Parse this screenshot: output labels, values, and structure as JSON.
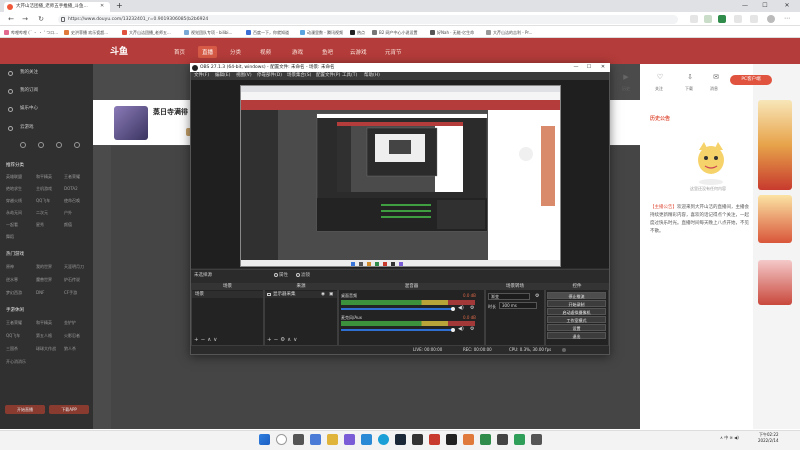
{
  "browser": {
    "tab_title": "大芹山洁团播_老师五手推播_斗鱼...",
    "url": "https://www.douyu.com/13232401_r=0.9019306085(b2b6924",
    "bookmarks": [
      "哔哩哔哩 (´ ・ ・ ‘ つロ...",
      "史洪菲播 欢乐瓷超...",
      "大芹山洁团播_老师五...",
      "视觉团队专项 - bilibi...",
      "百度一下，你就知道",
      "动漫里数 - 腾讯视频",
      "热点",
      "B2 网产中心小说设置",
      "好Nah · 无能·亿生命",
      "大芹山洁的吉利 - Pr..."
    ],
    "controls": {
      "minimize": "—",
      "maximize": "☐",
      "close": "✕",
      "new_tab": "+",
      "tab_close": "✕",
      "back": "←",
      "forward": "→",
      "refresh": "↻"
    }
  },
  "site": {
    "logo": "斗鱼",
    "nav": [
      "首页",
      "直播",
      "分类",
      "视频",
      "游戏",
      "鱼吧",
      "云游戏",
      "元宵节"
    ],
    "header_buttons": [
      "历史",
      "关注",
      "下载",
      "消息",
      "创作"
    ],
    "pc_client": "PC客户端",
    "sidebar": {
      "top_items": [
        "我的关注",
        "我的订阅",
        "娱乐中心",
        "云游戏"
      ],
      "section1_title": "推荐分类",
      "section1_items": [
        "英雄联盟",
        "和平精英",
        "王者荣耀",
        "绝地求生",
        "主机游戏",
        "DOTA2",
        "穿越火线",
        "QQ飞车",
        "使命召唤",
        "永劫无间",
        "二次元",
        "户外",
        "一起看",
        "星秀",
        "颜值",
        "舞蹈"
      ],
      "section2_title": "热门游戏",
      "section2_items": [
        "原神",
        "我的世界",
        "天涯明月刀",
        "逆水寒",
        "魔兽世界",
        "炉石传说",
        "梦幻西游",
        "DNF",
        "CF手游"
      ],
      "section3_title": "手游休闲",
      "section3_items": [
        "王者荣耀",
        "和平精英",
        "金铲铲",
        "QQ飞车",
        "第五人格",
        "火影忍者",
        "三国杀",
        "球球大作战",
        "狼人杀",
        "开心消消乐"
      ],
      "bottom_buttons": [
        "开始直播",
        "下载APP"
      ]
    },
    "streamer": {
      "name": "蒸日寺满徘",
      "follow": "关注"
    },
    "right_panel": {
      "title": "历史公告",
      "caption": "这里还没有任何内容",
      "tag": "【主播公告】",
      "text": "欢迎来到大芹山洁的直播间，主播会持续更新精彩内容，喜欢的话记得点个关注，一起度过快乐时光。直播时间每天晚上八点开始，不见不散。"
    }
  },
  "obs": {
    "title": "OBS 27.1.3 (64-bit, windows) - 配置文件: 未命名 - 场景: 未命名",
    "menu": [
      "文件(F)",
      "编辑(E)",
      "视图(V)",
      "停靠部件(D)",
      "场景集合(S)",
      "配置文件(P)",
      "工具(T)",
      "帮助(H)"
    ],
    "scene_label": "未选择源",
    "scene_options": [
      "属性",
      "滤镜"
    ],
    "docks": {
      "scenes": {
        "title": "场景",
        "items": [
          "场景"
        ]
      },
      "sources": {
        "title": "来源",
        "items": [
          "显示器采集"
        ]
      },
      "mixer": {
        "title": "混音器",
        "channels": [
          {
            "name": "桌面音频",
            "db": "0.0 dB"
          },
          {
            "name": "麦克风/Aux",
            "db": "0.0 dB"
          }
        ]
      },
      "transitions": {
        "title": "场景转场",
        "type": "渐变",
        "duration_label": "时长",
        "duration": "300 ms"
      },
      "controls": {
        "title": "控件",
        "buttons": [
          "停止推流",
          "开始录制",
          "启动虚拟摄像机",
          "工作室模式",
          "设置",
          "退出"
        ]
      }
    },
    "status": {
      "live": "LIVE: 00:00:00",
      "rec": "REC: 00:00:00",
      "cpu": "CPU: 0.3%, 30.00 fps"
    }
  },
  "taskbar": {
    "tray": "中",
    "time": "下午02:22",
    "date": "2022/2/14"
  },
  "colors": {
    "brand": "#b43c3a",
    "accent": "#e0533e",
    "obs_bg": "#2b2b2b"
  }
}
